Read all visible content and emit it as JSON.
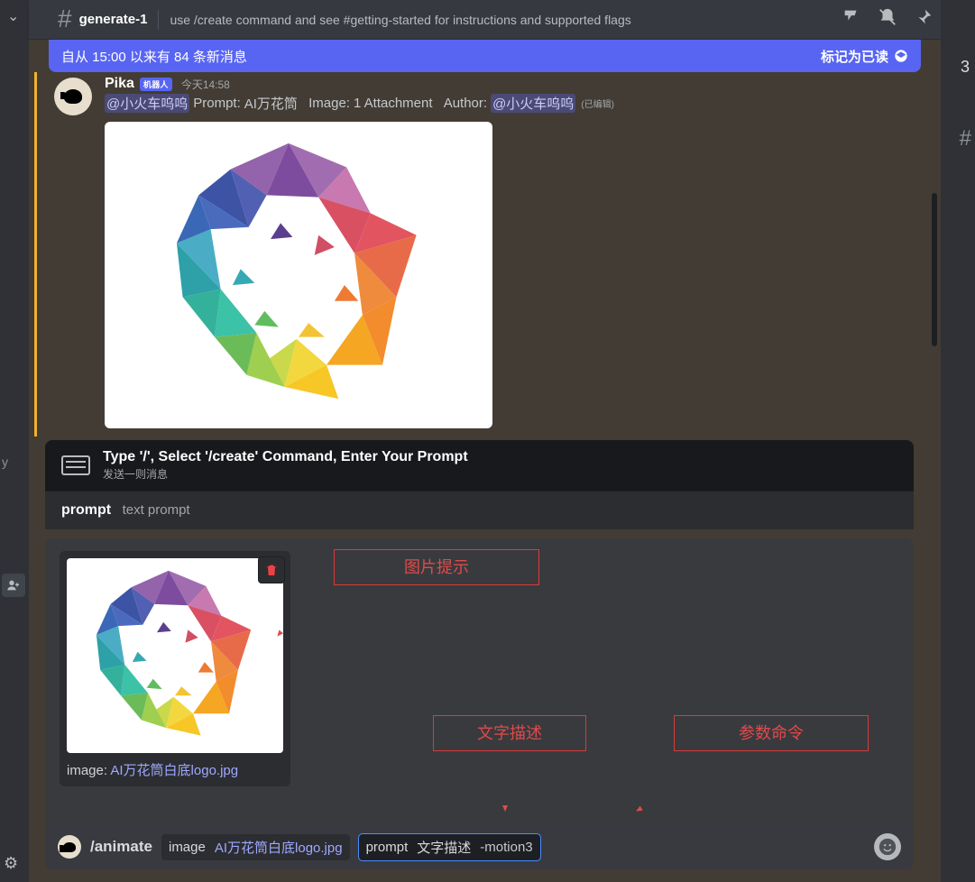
{
  "topbar": {
    "channel_name": "generate-1",
    "channel_desc": "use /create command and see #getting-started for instructions and supported flags"
  },
  "right_peek": {
    "count": "3"
  },
  "new_bar": {
    "left": "自从 15:00 以来有 84 条新消息",
    "right": "标记为已读"
  },
  "message": {
    "author": "Pika",
    "bot_tag": "机器人",
    "timestamp": "今天14:58",
    "mention1": "@小火车呜呜",
    "prompt_label": "Prompt:",
    "prompt_value": "AI万花筒",
    "image_label": "Image:",
    "image_value": "1 Attachment",
    "author_label": "Author:",
    "mention2": "@小火车呜呜",
    "edited": "(已编辑)"
  },
  "cmd_header": {
    "title": "Type '/', Select '/create' Command, Enter Your Prompt",
    "sub": "发送一则消息"
  },
  "prompt_row": {
    "label": "prompt",
    "desc": "text prompt"
  },
  "attachment": {
    "prefix": "image: ",
    "filename": "AI万花筒白底logo.jpg"
  },
  "callouts": {
    "c1": "图片提示",
    "c2": "文字描述",
    "c3": "参数命令"
  },
  "input": {
    "command": "/animate",
    "param1_label": "image",
    "param1_value": "AI万花筒白底logo.jpg",
    "param2_label": "prompt",
    "param2_free": "文字描述",
    "param2_flag": "-motion3"
  }
}
